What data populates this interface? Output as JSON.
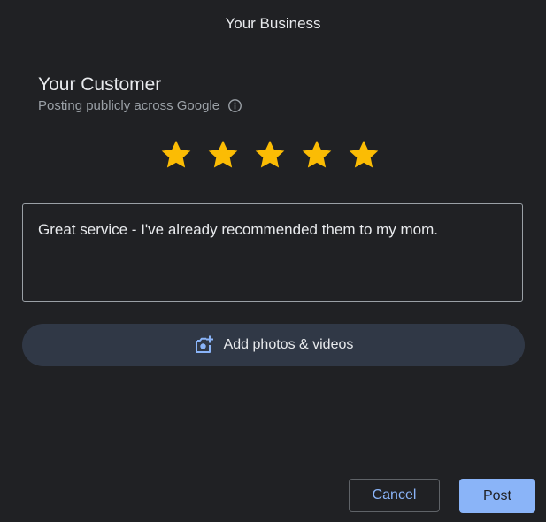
{
  "header": {
    "title": "Your Business"
  },
  "reviewer": {
    "name": "Your Customer",
    "posting_notice": "Posting publicly across Google",
    "info_icon": "info-icon"
  },
  "rating": {
    "value": 5,
    "max": 5,
    "star_color": "#fbbc04",
    "icon": "star-icon"
  },
  "review": {
    "text": "Great service - I've already recommended them to my mom."
  },
  "media": {
    "button_label": "Add photos & videos",
    "icon": "add-photo-icon",
    "icon_color": "#8ab4f8"
  },
  "actions": {
    "cancel_label": "Cancel",
    "post_label": "Post"
  },
  "colors": {
    "background": "#202124",
    "accent": "#8ab4f8",
    "secondary_text": "#9aa0a6",
    "media_button_bg": "#303846"
  }
}
